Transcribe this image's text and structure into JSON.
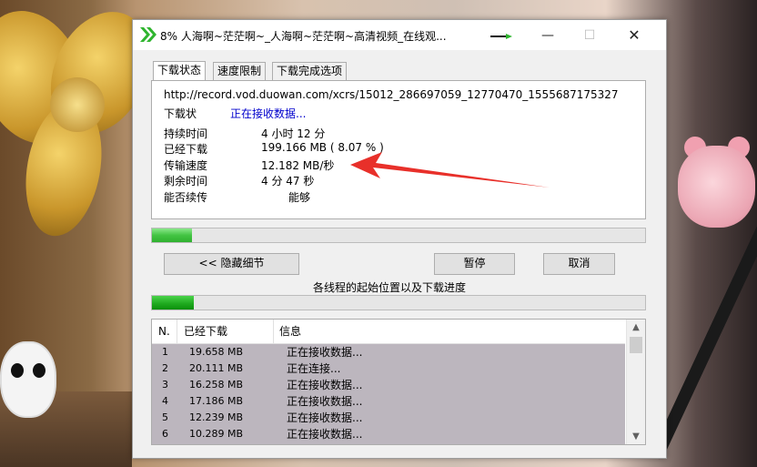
{
  "window": {
    "title": "8% 人海啊~茫茫啊~_人海啊~茫茫啊~高清视频_在线观...",
    "minimize_glyph": "—",
    "maximize_glyph": "☐",
    "close_glyph": "✕"
  },
  "tabs": [
    {
      "label": "下载状态",
      "active": true
    },
    {
      "label": "速度限制",
      "active": false
    },
    {
      "label": "下载完成选项",
      "active": false
    }
  ],
  "status_panel": {
    "url": "http://record.vod.duowan.com/xcrs/15012_286697059_12770470_1555687175327",
    "status_label": "下载状",
    "status_value": "正在接收数据...",
    "rows": [
      {
        "label": "持续时间",
        "value": "4 小时 12 分"
      },
      {
        "label": "已经下载",
        "value": "199.166  MB  ( 8.07 % )"
      },
      {
        "label": "传输速度",
        "value": "12.182  MB/秒"
      },
      {
        "label": "剩余时间",
        "value": "4 分 47 秒"
      },
      {
        "label": "能否续传",
        "value": "能够"
      }
    ]
  },
  "progress": {
    "overall_fraction": 0.0807,
    "threads_fraction": 0.085
  },
  "buttons": {
    "hide_details": "<< 隐藏细节",
    "pause": "暂停",
    "cancel": "取消"
  },
  "thread_caption": "各线程的起始位置以及下载进度",
  "thread_list": {
    "columns": [
      "N.",
      "已经下载",
      "信息"
    ],
    "rows": [
      {
        "n": "1",
        "downloaded": "19.658  MB",
        "info": "正在接收数据..."
      },
      {
        "n": "2",
        "downloaded": "20.111  MB",
        "info": "正在连接..."
      },
      {
        "n": "3",
        "downloaded": "16.258  MB",
        "info": "正在接收数据..."
      },
      {
        "n": "4",
        "downloaded": "17.186  MB",
        "info": "正在接收数据..."
      },
      {
        "n": "5",
        "downloaded": "12.239  MB",
        "info": "正在接收数据..."
      },
      {
        "n": "6",
        "downloaded": "10.289  MB",
        "info": "正在接收数据..."
      }
    ],
    "scroll_up_glyph": "▲",
    "scroll_down_glyph": "▼"
  },
  "colors": {
    "progress_green": "#1ea81e",
    "status_blue": "#0000cc",
    "annotation_red": "#e8302a",
    "list_row_bg": "#bcb6be"
  }
}
